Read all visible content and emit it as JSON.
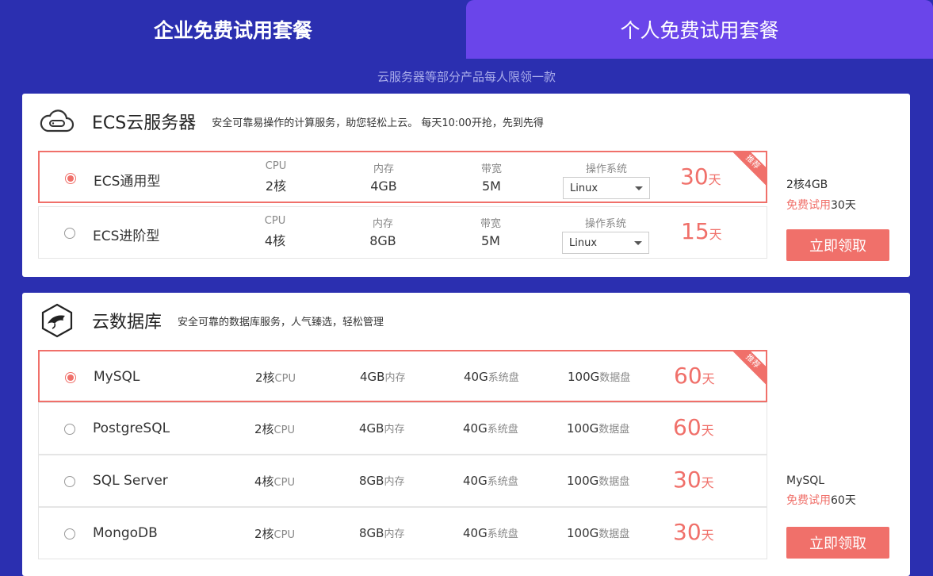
{
  "tabs": {
    "enterprise": "企业免费试用套餐",
    "personal": "个人免费试用套餐"
  },
  "subtitle": "云服务器等部分产品每人限领一款",
  "ecs": {
    "title": "ECS云服务器",
    "desc": "安全可靠易操作的计算服务，助您轻松上云。 每天10:00开抢，先到先得",
    "labels": {
      "cpu": "CPU",
      "mem": "内存",
      "bw": "带宽",
      "os": "操作系统"
    },
    "ribbon": "推荐",
    "rows": [
      {
        "name": "ECS通用型",
        "cpu": "2核",
        "mem": "4GB",
        "bw": "5M",
        "os": "Linux",
        "days": "30",
        "unit": "天"
      },
      {
        "name": "ECS进阶型",
        "cpu": "4核",
        "mem": "8GB",
        "bw": "5M",
        "os": "Linux",
        "days": "15",
        "unit": "天"
      }
    ],
    "side": {
      "spec": "2核4GB",
      "trial_hl": "免费试用",
      "trial_days": "30天"
    },
    "button": "立即领取"
  },
  "db": {
    "title": "云数据库",
    "desc": "安全可靠的数据库服务，人气臻选，轻松管理",
    "ribbon": "推荐",
    "units": {
      "cpu": "CPU",
      "mem": "内存",
      "sys": "系统盘",
      "data": "数据盘"
    },
    "rows": [
      {
        "name": "MySQL",
        "cpu": "2核",
        "mem": "4GB",
        "sys": "40G",
        "data": "100G",
        "days": "60",
        "unit": "天"
      },
      {
        "name": "PostgreSQL",
        "cpu": "2核",
        "mem": "4GB",
        "sys": "40G",
        "data": "100G",
        "days": "60",
        "unit": "天"
      },
      {
        "name": "SQL Server",
        "cpu": "4核",
        "mem": "8GB",
        "sys": "40G",
        "data": "100G",
        "days": "30",
        "unit": "天"
      },
      {
        "name": "MongoDB",
        "cpu": "2核",
        "mem": "8GB",
        "sys": "40G",
        "data": "100G",
        "days": "30",
        "unit": "天"
      }
    ],
    "side": {
      "spec": "MySQL",
      "trial_hl": "免费试用",
      "trial_days": "60天"
    },
    "button": "立即领取"
  },
  "colors": {
    "background": "#2b2fb0",
    "tab_active": "#6a45ea",
    "accent": "#f0706a"
  }
}
